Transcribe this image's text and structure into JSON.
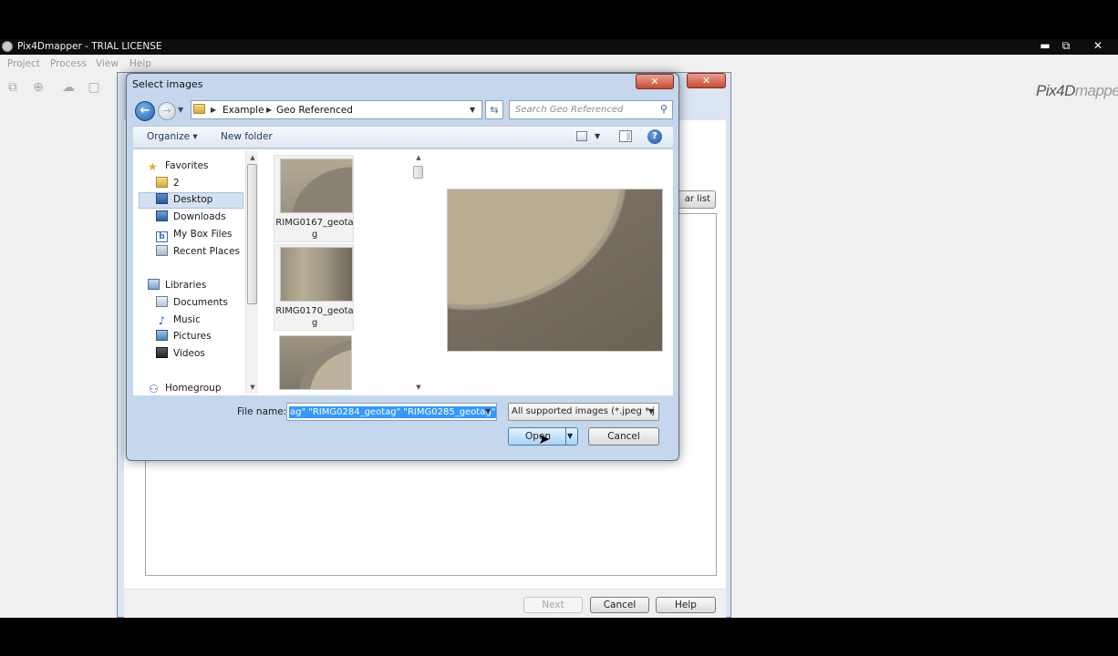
{
  "app": {
    "title": "Pix4Dmapper - TRIAL LICENSE",
    "menu": [
      "Project",
      "Process",
      "View",
      "Help"
    ],
    "logo_text": "Pix4D",
    "logo_tail": "mapper",
    "window_controls": {
      "minimize": "▬",
      "restore": "⧉",
      "close": "✕"
    }
  },
  "wizard": {
    "clear_list_label": "ar list",
    "buttons": {
      "next": "Next",
      "cancel": "Cancel",
      "help": "Help"
    },
    "close_glyph": "✕"
  },
  "dialog": {
    "title": "Select images",
    "close_glyph": "✕",
    "breadcrumb": [
      "Example",
      "Geo Referenced"
    ],
    "search_placeholder": "Search Geo Referenced",
    "toolbar": {
      "organize": "Organize ▾",
      "new_folder": "New folder"
    },
    "nav": {
      "favorites_label": "Favorites",
      "favorites": [
        "2",
        "Desktop",
        "Downloads",
        "My Box Files",
        "Recent Places"
      ],
      "libraries_label": "Libraries",
      "libraries": [
        "Documents",
        "Music",
        "Pictures",
        "Videos"
      ],
      "homegroup_label": "Homegroup",
      "selected": "Desktop"
    },
    "files": [
      {
        "name": "RIMG0167_geotag",
        "selected": true
      },
      {
        "name": "RIMG0170_geotag",
        "selected": true
      },
      {
        "name": "",
        "selected": false
      }
    ],
    "file_name_label": "File name:",
    "file_name_value": "ag\" \"RIMG0284_geotag\" \"RIMG0285_geotag\"",
    "file_type": "All supported images (*.jpeg *.j",
    "open_label": "Open",
    "cancel_label": "Cancel",
    "icons": {
      "back": "back-arrow-icon",
      "forward": "forward-arrow-icon",
      "refresh": "refresh-icon",
      "search": "search-icon",
      "help": "help-icon"
    }
  },
  "colors": {
    "dialog_frame": "#c4d7ec",
    "selection": "#3399ff",
    "close_red": "#c54a34"
  }
}
